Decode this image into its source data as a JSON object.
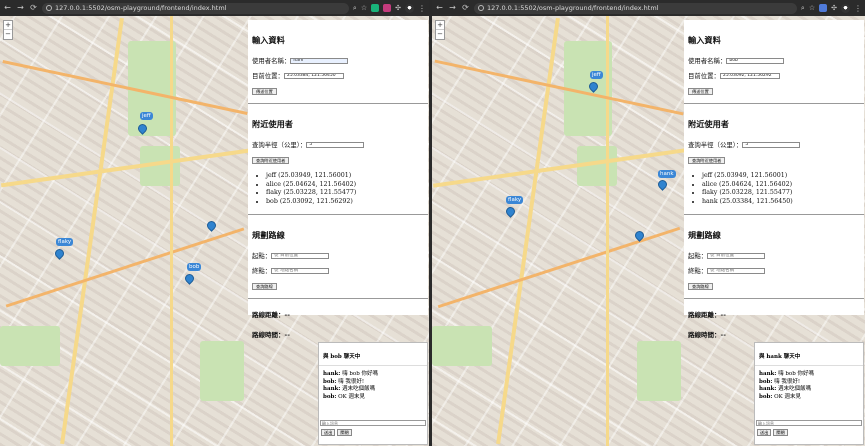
{
  "browser": {
    "url": "127.0.0.1:5502/osm-playground/frontend/index.html"
  },
  "left": {
    "form": {
      "input_title": "輸入資料",
      "username_label": "使用者名稱：",
      "username_value": "ham",
      "location_label": "目前位置：",
      "location_value": "25.03384, 121.56450",
      "update_button": "傳送位置",
      "nearby_title": "附近使用者",
      "radius_label": "查詢半徑（公里）：",
      "radius_value": "5",
      "query_button": "查詢附近使用者",
      "nearby_users": [
        "jeff (25.03949, 121.56001)",
        "alice (25.04624, 121.56402)",
        "flaky (25.03228, 121.55477)",
        "bob (25.03092, 121.56292)"
      ],
      "route_title": "規劃路線",
      "start_label": "起點：",
      "start_placeholder": "從 目前位置",
      "end_label": "終點：",
      "end_placeholder": "從 地點名稱",
      "route_button": "查詢路線",
      "distance_label": "路線距離：--",
      "duration_label": "路線時間：--"
    },
    "chat": {
      "title": "與 bob 聊天中",
      "messages": [
        {
          "sender": "hank:",
          "text": "嗨 bob 你好嗎"
        },
        {
          "sender": "bob:",
          "text": "嗨 我很好!"
        },
        {
          "sender": "hank:",
          "text": "週末吃個飯嗎"
        },
        {
          "sender": "bob:",
          "text": "OK 週末見"
        }
      ],
      "input_placeholder": "輸入訊息",
      "send_button": "送出",
      "close_button": "關閉"
    },
    "map_labels": [
      "jeff",
      "flaky",
      "bob"
    ]
  },
  "right": {
    "form": {
      "input_title": "輸入資料",
      "username_label": "使用者名稱：",
      "username_value": "bob",
      "location_label": "目前位置：",
      "location_value": "25.03092, 121.56292",
      "update_button": "傳送位置",
      "nearby_title": "附近使用者",
      "radius_label": "查詢半徑（公里）：",
      "radius_value": "5",
      "query_button": "查詢附近使用者",
      "nearby_users": [
        "jeff (25.03949, 121.56001)",
        "alice (25.04624, 121.56402)",
        "flaky (25.03228, 121.55477)",
        "hank (25.03384, 121.56450)"
      ],
      "route_title": "規劃路線",
      "start_label": "起點：",
      "start_placeholder": "從 目前位置",
      "end_label": "終點：",
      "end_placeholder": "從 地點名稱",
      "route_button": "查詢路線",
      "distance_label": "路線距離：--",
      "duration_label": "路線時間：--"
    },
    "chat": {
      "title": "與 hank 聊天中",
      "messages": [
        {
          "sender": "hank:",
          "text": "嗨 bob 你好嗎"
        },
        {
          "sender": "bob:",
          "text": "嗨 我很好!"
        },
        {
          "sender": "hank:",
          "text": "週末吃個飯嗎"
        },
        {
          "sender": "bob:",
          "text": "OK 週末見"
        }
      ],
      "input_placeholder": "輸入訊息",
      "send_button": "送出",
      "close_button": "關閉"
    },
    "map_labels": [
      "jeff",
      "hank",
      "flaky"
    ]
  },
  "colors": {
    "map_bg": "#e6e0d6",
    "park": "#c9e3b3",
    "marker": "#2f83cf",
    "chrome": "#2b2b2b"
  }
}
